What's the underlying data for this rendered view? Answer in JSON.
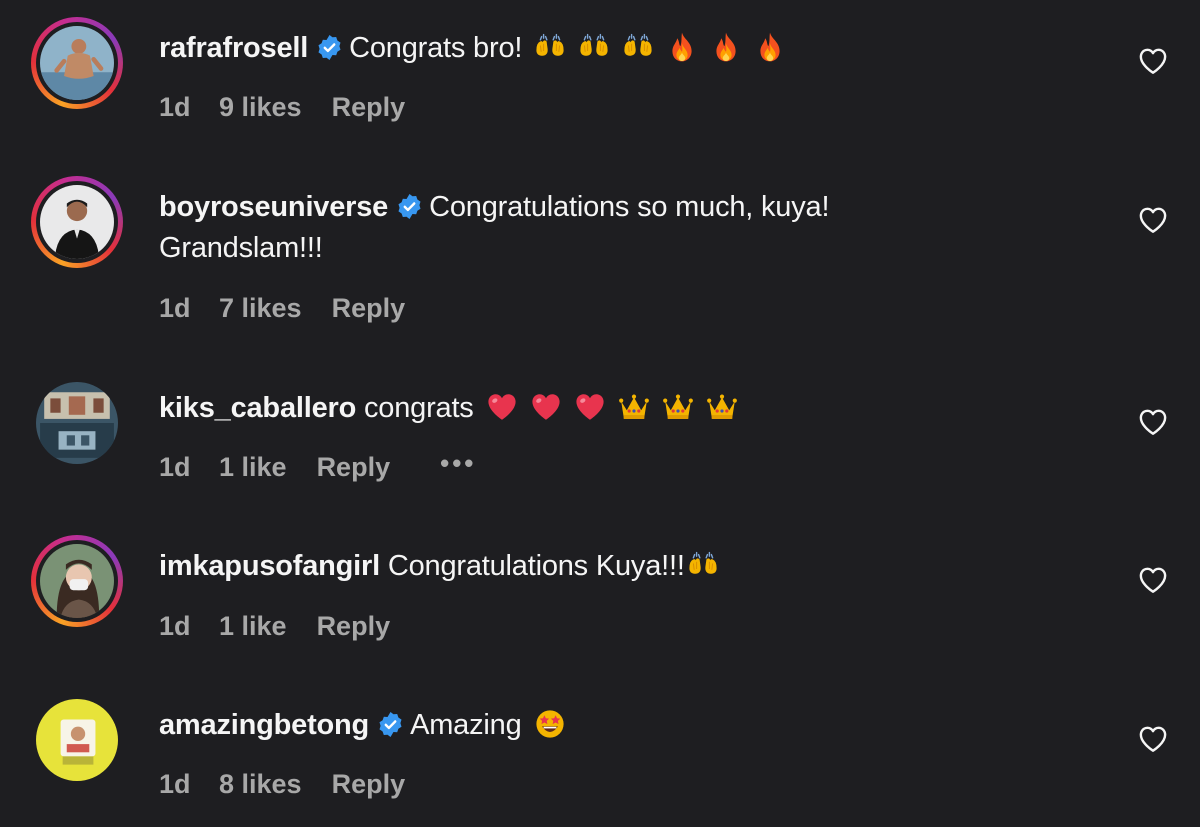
{
  "comments": [
    {
      "username": "rafrafrosell",
      "verified": true,
      "text": "Congrats bro!",
      "emojis": [
        "raising-hands-emoji",
        "raising-hands-emoji",
        "raising-hands-emoji",
        "fire-emoji",
        "fire-emoji",
        "fire-emoji"
      ],
      "time": "1d",
      "likes": "9 likes",
      "reply": "Reply"
    },
    {
      "username": "boyroseuniverse",
      "verified": true,
      "text": "Congratulations so much, kuya!",
      "text_line2": "Grandslam!!!",
      "time": "1d",
      "likes": "7 likes",
      "reply": "Reply"
    },
    {
      "username": "kiks_caballero",
      "verified": false,
      "text": "congrats",
      "emojis": [
        "red-heart-emoji",
        "red-heart-emoji",
        "red-heart-emoji",
        "crown-emoji",
        "crown-emoji",
        "crown-emoji"
      ],
      "time": "1d",
      "likes": "1 like",
      "reply": "Reply",
      "more": "•••"
    },
    {
      "username": "imkapusofangirl",
      "verified": false,
      "text": "Congratulations Kuya!!!",
      "emojis": [
        "raising-hands-emoji"
      ],
      "time": "1d",
      "likes": "1 like",
      "reply": "Reply"
    },
    {
      "username": "amazingbetong",
      "verified": true,
      "text": "Amazing",
      "emojis": [
        "star-struck-emoji"
      ],
      "time": "1d",
      "likes": "8 likes",
      "reply": "Reply"
    }
  ],
  "colors": {
    "background": "#1e1e21",
    "text": "#f5f5f5",
    "meta": "#a8a8a8",
    "verified_badge": "#3897f0"
  }
}
